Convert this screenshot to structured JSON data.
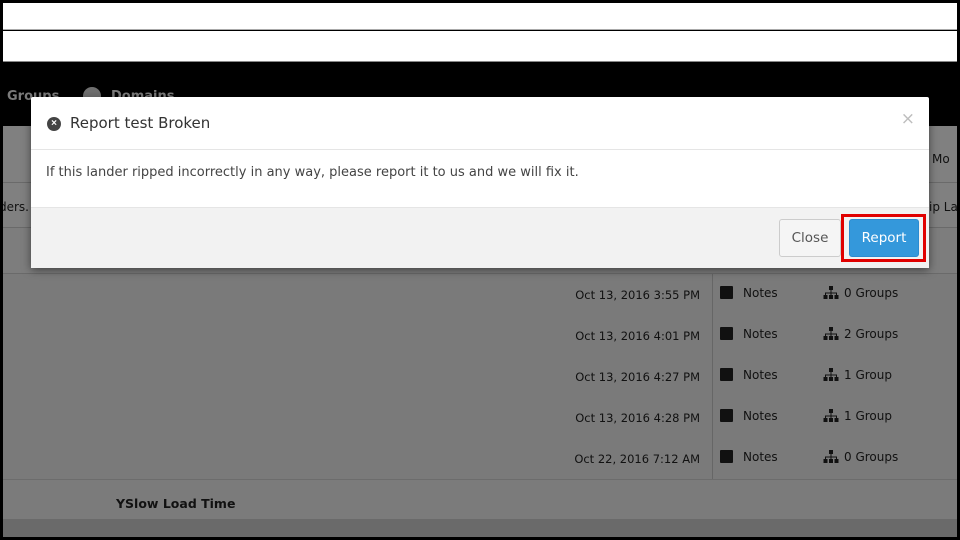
{
  "nav": {
    "groups_label": "Groups",
    "domains_label": "Domains"
  },
  "background": {
    "edge_texts": {
      "mo": "Mo",
      "ders": "ders.",
      "ip_la": "ip La"
    },
    "rows": [
      {
        "date": "Oct 13, 2016 3:55 PM",
        "notes": "Notes",
        "groups": "0 Groups"
      },
      {
        "date": "Oct 13, 2016 4:01 PM",
        "notes": "Notes",
        "groups": "2 Groups"
      },
      {
        "date": "Oct 13, 2016 4:27 PM",
        "notes": "Notes",
        "groups": "1 Group"
      },
      {
        "date": "Oct 13, 2016 4:28 PM",
        "notes": "Notes",
        "groups": "1 Group"
      },
      {
        "date": "Oct 22, 2016 7:12 AM",
        "notes": "Notes",
        "groups": "0 Groups"
      }
    ],
    "yslow_label": "YSlow Load Time"
  },
  "modal": {
    "title": "Report test Broken",
    "close_x": "×",
    "body": "If this lander ripped incorrectly in any way, please report it to us and we will fix it.",
    "close_button": "Close",
    "report_button": "Report"
  },
  "colors": {
    "primary": "#3498db",
    "highlight": "#e00000"
  }
}
